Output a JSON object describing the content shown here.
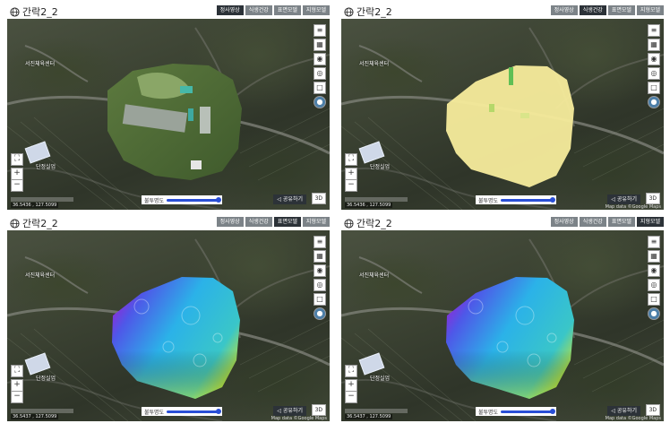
{
  "panels": [
    {
      "title": "간락2_2",
      "tabs": [
        "정사영상",
        "식생건강",
        "표면모델",
        "지형모델"
      ],
      "active_tab": 0,
      "opacity_label": "불투명도",
      "share_label": "공유하기",
      "view3d_label": "3D",
      "coordinate": "36.5436 , 127.5099",
      "attribution": "",
      "map_labels": [
        "서진체육센터",
        "단정실업"
      ],
      "overlay": "orthophoto"
    },
    {
      "title": "간락2_2",
      "tabs": [
        "정사영상",
        "식생건강",
        "표면모델",
        "지형모델"
      ],
      "active_tab": 1,
      "opacity_label": "불투명도",
      "share_label": "공유하기",
      "view3d_label": "3D",
      "coordinate": "36.5436 , 127.5099",
      "attribution": "Map data ©Google Maps",
      "map_labels": [
        "서진체육센터",
        "단정실업"
      ],
      "overlay": "vegetation"
    },
    {
      "title": "간락2_2",
      "tabs": [
        "정사영상",
        "식생건강",
        "표면모델",
        "지형모델"
      ],
      "active_tab": 2,
      "opacity_label": "불투명도",
      "share_label": "공유하기",
      "view3d_label": "3D",
      "coordinate": "36.5437 , 127.5099",
      "attribution": "Map data ©Google Maps",
      "map_labels": [
        "서진체육센터",
        "단정실업"
      ],
      "overlay": "surface"
    },
    {
      "title": "간락2_2",
      "tabs": [
        "정사영상",
        "식생건강",
        "표면모델",
        "지형모델"
      ],
      "active_tab": 3,
      "opacity_label": "불투명도",
      "share_label": "공유하기",
      "view3d_label": "3D",
      "coordinate": "36.5437 , 127.5099",
      "attribution": "Map data ©Google Maps",
      "map_labels": [
        "서진체육센터",
        "단정실업"
      ],
      "overlay": "terrain"
    }
  ],
  "icons": {
    "title": "globe-icon",
    "right_tools": [
      "layers-icon",
      "grid-icon",
      "location-icon",
      "target-icon",
      "square-icon",
      "earth-icon"
    ],
    "left_tools": [
      "fullscreen-icon",
      "zoom-in-icon",
      "zoom-out-icon"
    ]
  },
  "colors": {
    "tab": "#7c8388",
    "tab_active": "#2c3238",
    "slider": "#2a4fd6",
    "vegetation": "#f7ec9c",
    "surface_low": "#9a22d4",
    "surface_mid": "#2bb2e8",
    "surface_high": "#d7e61c"
  }
}
